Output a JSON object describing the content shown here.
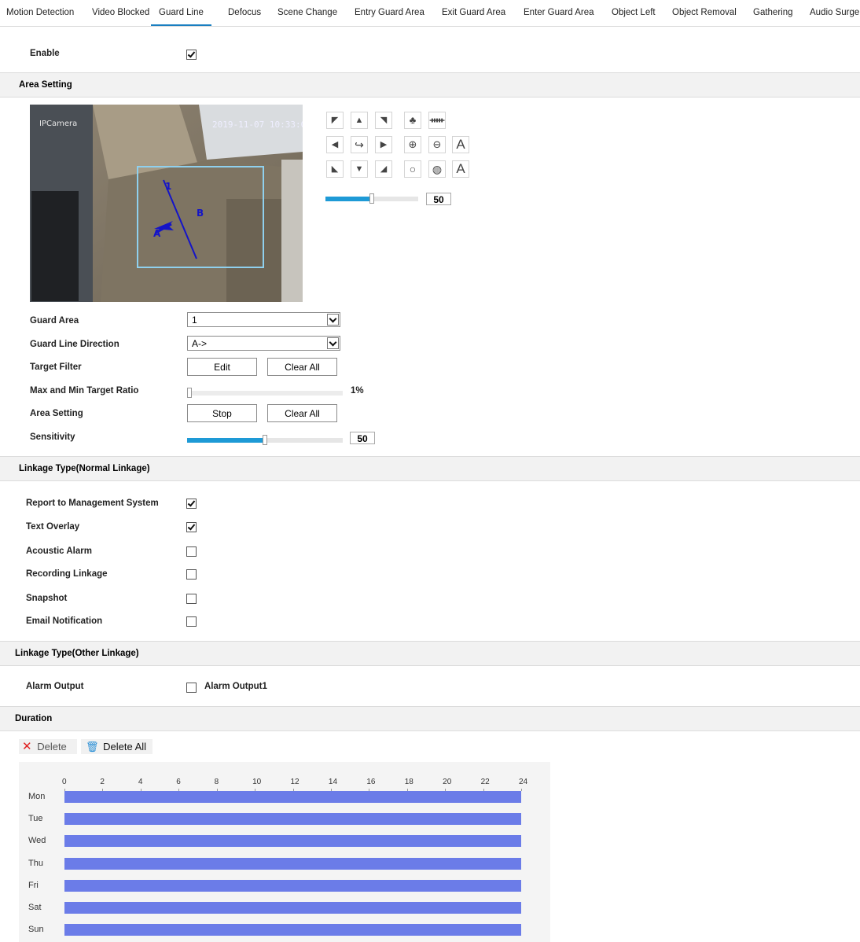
{
  "tabs": [
    "Motion Detection",
    "Video Blocked",
    "Guard Line",
    "Defocus",
    "Scene Change",
    "Entry Guard Area",
    "Exit Guard Area",
    "Enter Guard Area",
    "Object Left",
    "Object Removal",
    "Gathering",
    "Audio Surge"
  ],
  "active_tab": "Guard Line",
  "enable": {
    "label": "Enable",
    "checked": true
  },
  "area_setting_header": "Area Setting",
  "camera": {
    "osd_name": "IPCamera",
    "timestamp": "2019-11-07 10:33:0",
    "line_point_label": "1",
    "side_a": "A",
    "side_b": "B"
  },
  "ptz": {
    "zoom_slider": {
      "value": 50,
      "fraction": 0.5
    }
  },
  "fields": {
    "guard_area": {
      "label": "Guard Area",
      "value": "1"
    },
    "guard_line_direction": {
      "label": "Guard Line Direction",
      "value": "A->"
    },
    "target_filter": {
      "label": "Target Filter",
      "edit": "Edit",
      "clear": "Clear All"
    },
    "ratio": {
      "label": "Max and Min Target Ratio",
      "value_text": "1%",
      "fraction": 0.01
    },
    "area_setting": {
      "label": "Area Setting",
      "stop": "Stop",
      "clear": "Clear All"
    },
    "sensitivity": {
      "label": "Sensitivity",
      "value": "50",
      "fraction": 0.5
    }
  },
  "linkage_normal_header": "Linkage Type(Normal Linkage)",
  "linkage_normal": [
    {
      "label": "Report to Management System",
      "checked": true
    },
    {
      "label": "Text Overlay",
      "checked": true
    },
    {
      "label": "Acoustic Alarm",
      "checked": false
    },
    {
      "label": "Recording Linkage",
      "checked": false
    },
    {
      "label": "Snapshot",
      "checked": false
    },
    {
      "label": "Email Notification",
      "checked": false
    }
  ],
  "linkage_other_header": "Linkage Type(Other Linkage)",
  "alarm_output": {
    "label": "Alarm Output",
    "option": "Alarm Output1",
    "checked": false
  },
  "duration_header": "Duration",
  "duration_actions": {
    "delete": "Delete",
    "delete_all": "Delete All"
  },
  "schedule": {
    "hours": [
      "0",
      "2",
      "4",
      "6",
      "8",
      "10",
      "12",
      "14",
      "16",
      "18",
      "20",
      "22",
      "24"
    ],
    "days": [
      "Mon",
      "Tue",
      "Wed",
      "Thu",
      "Fri",
      "Sat",
      "Sun"
    ],
    "bar_color": "#6b7ce8",
    "ranges": [
      [
        0,
        24
      ],
      [
        0,
        24
      ],
      [
        0,
        24
      ],
      [
        0,
        24
      ],
      [
        0,
        24
      ],
      [
        0,
        24
      ],
      [
        0,
        24
      ]
    ]
  }
}
